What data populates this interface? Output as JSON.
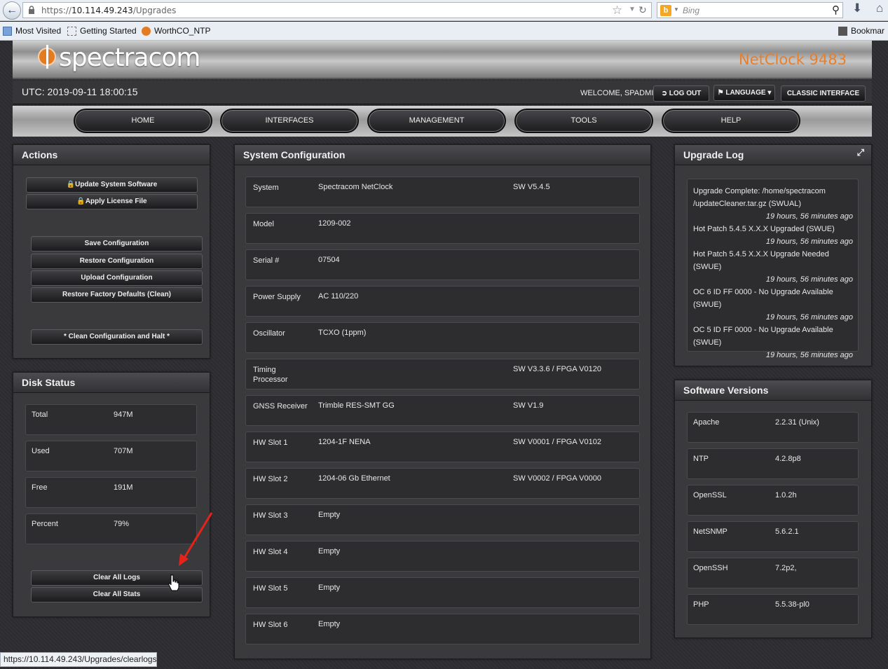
{
  "browser": {
    "url_prefix": "https://",
    "url_host": "10.114.49.243",
    "url_path": "/Upgrades",
    "search_placeholder": "Bing",
    "bookmarks": [
      "Most Visited",
      "Getting Started",
      "WorthCO_NTP",
      "Bookmar"
    ],
    "status_url": "https://10.114.49.243/Upgrades/clearlogs"
  },
  "header": {
    "logo_text": "spectracom",
    "product_name": "NetClock 9483",
    "utc_time": "UTC: 2019-09-11 18:00:15",
    "welcome": "WELCOME, SPADMIN",
    "logout_label": "LOG OUT",
    "language_label": "LANGUAGE",
    "classic_label": "CLASSIC INTERFACE"
  },
  "nav": [
    "HOME",
    "INTERFACES",
    "MANAGEMENT",
    "TOOLS",
    "HELP"
  ],
  "actions": {
    "title": "Actions",
    "update_software": "Update System Software",
    "apply_license": "Apply License File",
    "save_config": "Save Configuration",
    "restore_config": "Restore Configuration",
    "upload_config": "Upload Configuration",
    "restore_factory": "Restore Factory Defaults (Clean)",
    "clean_halt": "* Clean Configuration and Halt *"
  },
  "disk": {
    "title": "Disk Status",
    "rows": [
      {
        "k": "Total",
        "v": "947M"
      },
      {
        "k": "Used",
        "v": "707M"
      },
      {
        "k": "Free",
        "v": "191M"
      },
      {
        "k": "Percent",
        "v": "79%"
      }
    ],
    "clear_logs": "Clear All Logs",
    "clear_stats": "Clear All Stats"
  },
  "sysconfig": {
    "title": "System Configuration",
    "rows": [
      {
        "k": "System",
        "v": "Spectracom NetClock",
        "s": "SW V5.4.5"
      },
      {
        "k": "Model",
        "v": "1209-002",
        "s": ""
      },
      {
        "k": "Serial #",
        "v": "07504",
        "s": ""
      },
      {
        "k": "Power Supply",
        "v": "AC 110/220",
        "s": ""
      },
      {
        "k": "Oscillator",
        "v": "TCXO (1ppm)",
        "s": ""
      },
      {
        "k": "Timing Processor",
        "v": "",
        "s": "SW V3.3.6 / FPGA V0120"
      },
      {
        "k": "GNSS Receiver",
        "v": "Trimble RES-SMT GG",
        "s": "SW V1.9"
      },
      {
        "k": "HW Slot 1",
        "v": "1204-1F NENA",
        "s": "SW V0001 / FPGA V0102"
      },
      {
        "k": "HW Slot 2",
        "v": "1204-06 Gb Ethernet",
        "s": "SW V0002 / FPGA V0000"
      },
      {
        "k": "HW Slot 3",
        "v": "Empty",
        "s": ""
      },
      {
        "k": "HW Slot 4",
        "v": "Empty",
        "s": ""
      },
      {
        "k": "HW Slot 5",
        "v": "Empty",
        "s": ""
      },
      {
        "k": "HW Slot 6",
        "v": "Empty",
        "s": ""
      }
    ]
  },
  "upgrade_log": {
    "title": "Upgrade Log",
    "entries": [
      {
        "text": "Upgrade Complete: /home/spectracom /updateCleaner.tar.gz (SWUAL)",
        "time": "19 hours, 56 minutes ago"
      },
      {
        "text": "Hot Patch 5.4.5 X.X.X Upgraded (SWUE)",
        "time": "19 hours, 56 minutes ago"
      },
      {
        "text": "Hot Patch 5.4.5 X.X.X Upgrade Needed (SWUE)",
        "time": "19 hours, 56 minutes ago"
      },
      {
        "text": "OC 6 ID FF 0000 - No Upgrade Available (SWUE)",
        "time": "19 hours, 56 minutes ago"
      },
      {
        "text": "OC 5 ID FF 0000 - No Upgrade Available (SWUE)",
        "time": "19 hours, 56 minutes ago"
      }
    ]
  },
  "software": {
    "title": "Software Versions",
    "rows": [
      {
        "k": "Apache",
        "v": "2.2.31 (Unix)"
      },
      {
        "k": "NTP",
        "v": "4.2.8p8"
      },
      {
        "k": "OpenSSL",
        "v": "1.0.2h"
      },
      {
        "k": "NetSNMP",
        "v": "5.6.2.1"
      },
      {
        "k": "OpenSSH",
        "v": "7.2p2,"
      },
      {
        "k": "PHP",
        "v": "5.5.38-pl0"
      }
    ]
  },
  "colors": {
    "accent_orange": "#e87f2a",
    "annotation_arrow": "#e5231b"
  }
}
